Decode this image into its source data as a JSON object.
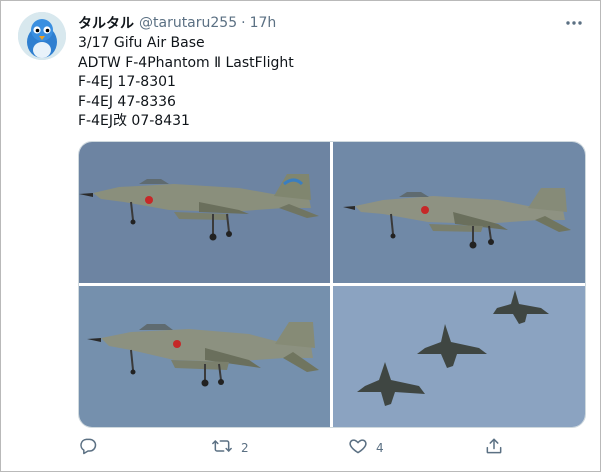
{
  "tweet": {
    "display_name": "タルタル",
    "handle": "@tarutaru255",
    "separator": "·",
    "time": "17h",
    "lines": [
      "3/17 Gifu Air Base",
      "ADTW F-4Phantom Ⅱ LastFlight",
      "F-4EJ 17-8301",
      "F-4EJ 47-8336",
      "F-4EJ改 07-8431"
    ]
  },
  "actions": {
    "reply_count": "",
    "retweet_count": "2",
    "like_count": "4"
  },
  "media": {
    "photos": [
      {
        "subject": "F-4 Phantom in flight, gear down, blue sky"
      },
      {
        "subject": "F-4 Phantom in flight, gear down, blue sky"
      },
      {
        "subject": "F-4 Phantom in flight, gear down, blue sky"
      },
      {
        "subject": "three F-4 Phantoms from below"
      }
    ]
  },
  "icons": {
    "more": "more-horizontal-icon",
    "reply": "reply-icon",
    "retweet": "retweet-icon",
    "like": "heart-icon",
    "share": "share-icon"
  },
  "colors": {
    "text": "#0f1419",
    "secondary": "#5b7083",
    "border": "#cfd9de",
    "sky": "#6f86a4"
  }
}
